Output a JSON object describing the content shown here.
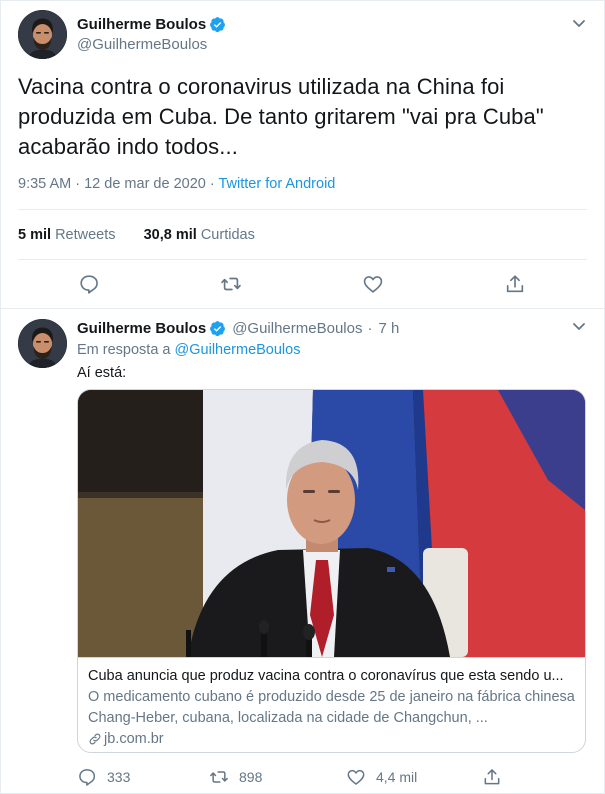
{
  "main_tweet": {
    "author_name": "Guilherme Boulos",
    "author_handle": "@GuilhermeBoulos",
    "text": "Vacina contra o coronavirus utilizada na China foi produzida em Cuba. De tanto gritarem \"vai pra Cuba\" acabarão indo todos...",
    "time": "9:35 AM",
    "date": "12 de mar de 2020",
    "separator": "·",
    "client": "Twitter for Android",
    "retweets_count": "5 mil",
    "retweets_label": "Retweets",
    "likes_count": "30,8 mil",
    "likes_label": "Curtidas",
    "icons": {
      "verified": "verified-badge-icon",
      "caret": "chevron-down-icon",
      "reply": "reply-icon",
      "retweet": "retweet-icon",
      "like": "heart-icon",
      "share": "share-icon"
    }
  },
  "reply_tweet": {
    "author_name": "Guilherme Boulos",
    "author_handle": "@GuilhermeBoulos",
    "separator": "·",
    "age": "7 h",
    "reply_prefix": "Em resposta a",
    "reply_mention": "@GuilhermeBoulos",
    "text": "Aí está:",
    "card": {
      "title": "Cuba anuncia que produz vacina contra o coronavírus que esta sendo u...",
      "description": "O medicamento cubano é produzido desde 25 de janeiro na fábrica chinesa Chang-Heber, cubana, localizada na cidade de Changchun, ...",
      "domain": "jb.com.br",
      "icons": {
        "link": "link-icon"
      }
    },
    "replies": "333",
    "retweets": "898",
    "likes": "4,4 mil"
  },
  "colors": {
    "link_blue": "#1b95e0",
    "verified_blue": "#1da1f2",
    "text_primary": "#14171a",
    "text_secondary": "#657786",
    "border": "#e6ecf0"
  }
}
